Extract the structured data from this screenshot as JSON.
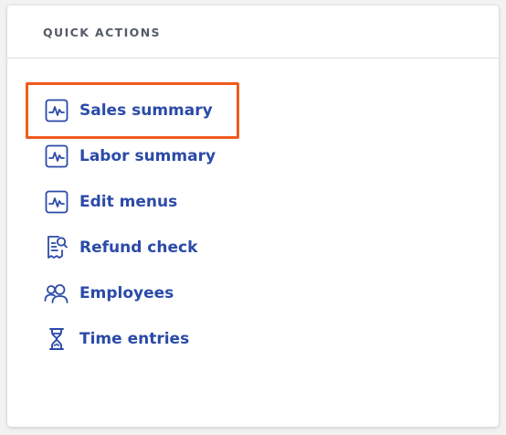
{
  "card": {
    "title": "QUICK ACTIONS"
  },
  "actions": [
    {
      "label": "Sales summary",
      "icon": "chart-line-icon",
      "highlighted": true
    },
    {
      "label": "Labor summary",
      "icon": "chart-line-icon",
      "highlighted": false
    },
    {
      "label": "Edit menus",
      "icon": "chart-line-icon",
      "highlighted": false
    },
    {
      "label": "Refund check",
      "icon": "receipt-search-icon",
      "highlighted": false
    },
    {
      "label": "Employees",
      "icon": "people-icon",
      "highlighted": false
    },
    {
      "label": "Time entries",
      "icon": "hourglass-icon",
      "highlighted": false
    }
  ],
  "colors": {
    "link": "#2b4aa8",
    "highlight_border": "#f05a1e",
    "title": "#555b66",
    "divider": "#dcdcdc"
  }
}
